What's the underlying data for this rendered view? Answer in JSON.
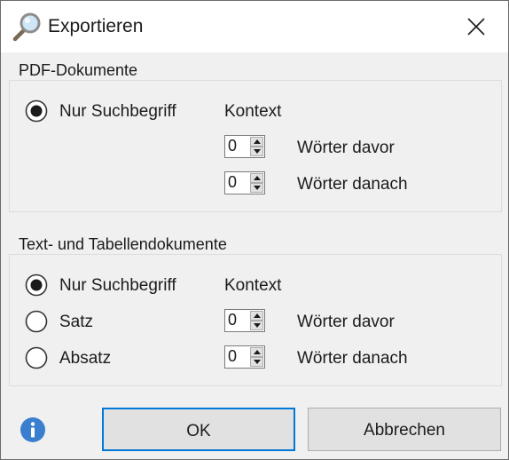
{
  "dialog": {
    "title": "Exportieren",
    "icon": "magnifier-icon"
  },
  "pdf_group": {
    "title": "PDF-Dokumente",
    "radio_label": "Nur Suchbegriff",
    "radio_selected": true,
    "context_label": "Kontext",
    "words_before": {
      "value": "0",
      "label": "Wörter davor"
    },
    "words_after": {
      "value": "0",
      "label": "Wörter danach"
    }
  },
  "text_group": {
    "title": "Text- und Tabellendokumente",
    "options": [
      {
        "label": "Nur Suchbegriff",
        "selected": true
      },
      {
        "label": "Satz",
        "selected": false
      },
      {
        "label": "Absatz",
        "selected": false
      }
    ],
    "context_label": "Kontext",
    "words_before": {
      "value": "0",
      "label": "Wörter davor"
    },
    "words_after": {
      "value": "0",
      "label": "Wörter danach"
    }
  },
  "footer": {
    "info_icon": "info-icon",
    "ok_label": "OK",
    "cancel_label": "Abbrechen"
  },
  "colors": {
    "accent": "#0078d7",
    "info": "#3a7ecf",
    "background": "#f0f0f0"
  }
}
